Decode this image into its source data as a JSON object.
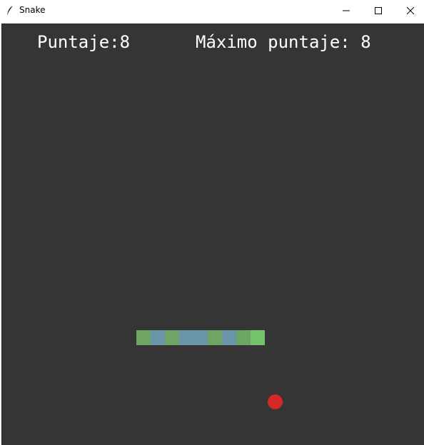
{
  "window": {
    "title": "Snake",
    "icon": "feather-icon",
    "controls": [
      "minimize-icon",
      "maximize-icon",
      "close-icon"
    ]
  },
  "game": {
    "score_label": "Puntaje:8",
    "high_score_label": "Máximo puntaje: 8",
    "background_color": "#353535",
    "text_color": "#ffffff",
    "snake": {
      "length": 9,
      "segment_colors": [
        "#6ea564",
        "#6b95a8",
        "#6ea564",
        "#6b95a8",
        "#6b95a8",
        "#6ea564",
        "#6b95a8",
        "#6ea564",
        "#73c46b"
      ],
      "head_color": "#73c46b",
      "direction": "right"
    },
    "food": {
      "shape": "circle",
      "color": "#d62828"
    }
  }
}
